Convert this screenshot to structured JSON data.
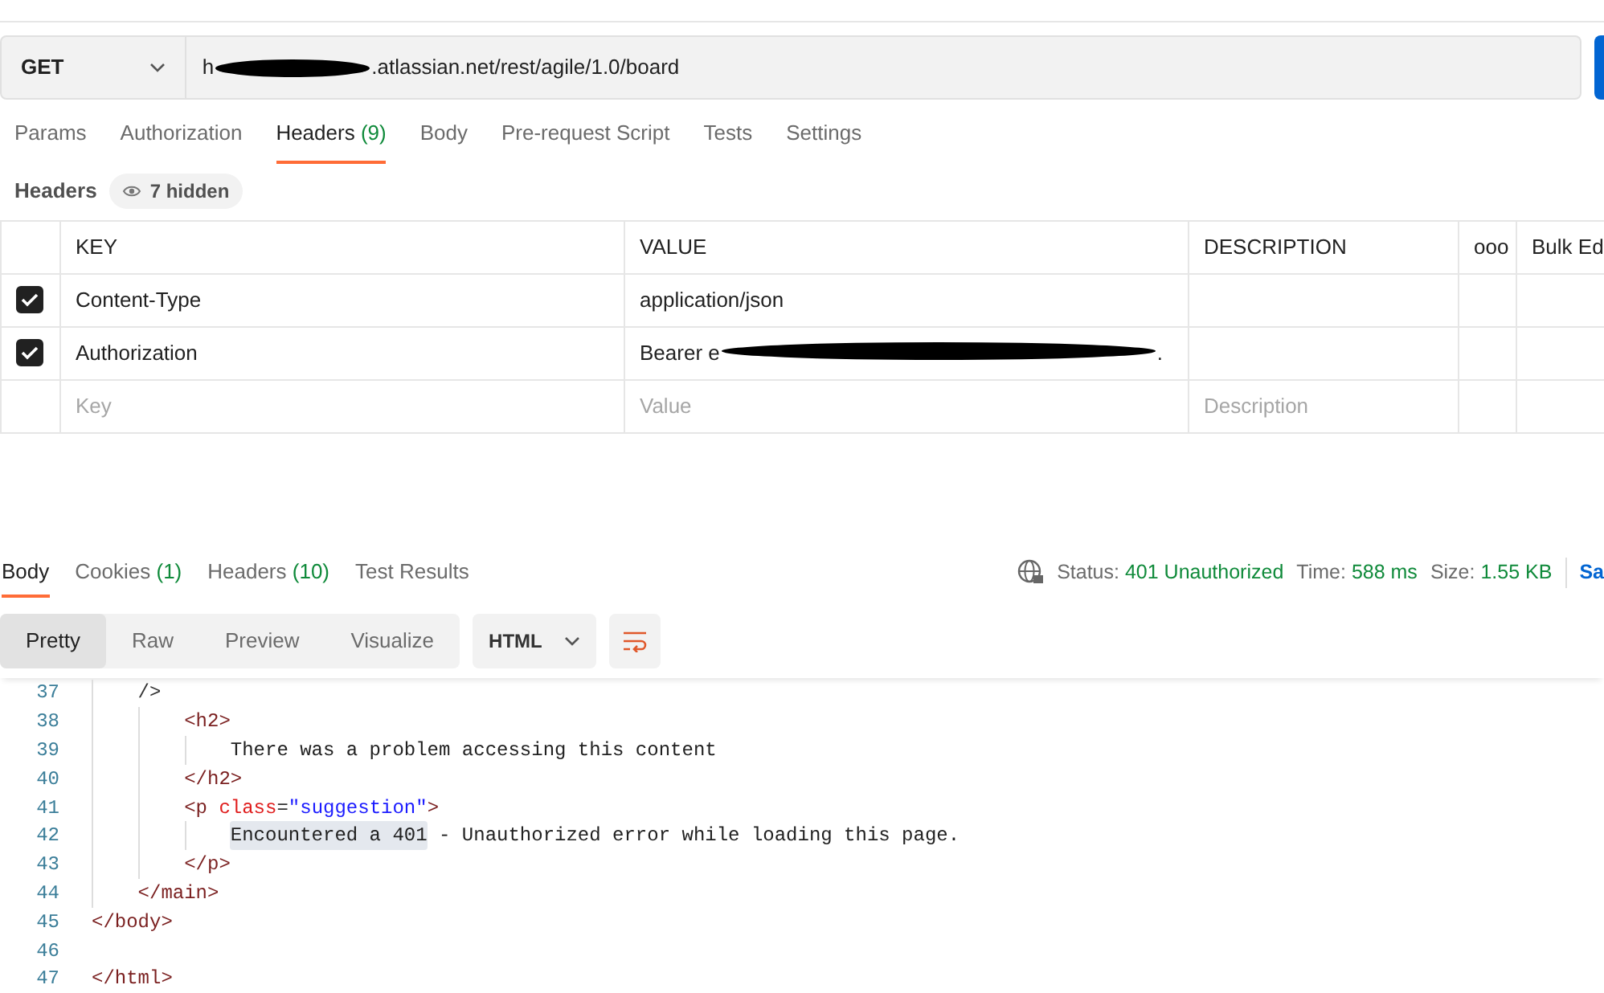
{
  "request": {
    "method": "GET",
    "url_parts": [
      {
        "kind": "text",
        "text": "h"
      },
      {
        "kind": "redaction"
      },
      {
        "kind": "text",
        "text": ".atlassian.net/rest/agile/1.0/board"
      }
    ]
  },
  "request_tabs": [
    {
      "label": "Params",
      "selected": false
    },
    {
      "label": "Authorization",
      "selected": false
    },
    {
      "label": "Headers",
      "count": "(9)",
      "selected": true
    },
    {
      "label": "Body",
      "selected": false
    },
    {
      "label": "Pre-request Script",
      "selected": false
    },
    {
      "label": "Tests",
      "selected": false
    },
    {
      "label": "Settings",
      "selected": false
    }
  ],
  "headers_bar": {
    "title": "Headers",
    "hidden_badge": "7 hidden"
  },
  "headers_table": {
    "columns": [
      "KEY",
      "VALUE",
      "DESCRIPTION"
    ],
    "more": "ooo",
    "bulk_edit": "Bulk Ed",
    "rows": [
      {
        "checked": true,
        "key": "Content-Type",
        "value_parts": [
          {
            "kind": "text",
            "text": "application/json"
          }
        ]
      },
      {
        "checked": true,
        "key": "Authorization",
        "value_parts": [
          {
            "kind": "text",
            "text": "Bearer e"
          },
          {
            "kind": "redaction"
          },
          {
            "kind": "text",
            "text": "."
          }
        ]
      }
    ],
    "new_row": {
      "key": {
        "placeholder": "Key"
      },
      "value": {
        "placeholder": "Value"
      },
      "description": {
        "placeholder": "Description"
      }
    }
  },
  "response_tabs": [
    {
      "label": "Body",
      "selected": true
    },
    {
      "label": "Cookies",
      "count": "(1)",
      "selected": false
    },
    {
      "label": "Headers",
      "count": "(10)",
      "selected": false
    },
    {
      "label": "Test Results",
      "selected": false
    }
  ],
  "response_meta": {
    "status_label": "Status:",
    "status": "401 Unauthorized",
    "time_label": "Time:",
    "time": "588 ms",
    "size_label": "Size:",
    "size": "1.55 KB",
    "save": "Sa"
  },
  "view_modes": [
    {
      "label": "Pretty",
      "selected": true
    },
    {
      "label": "Raw",
      "selected": false
    },
    {
      "label": "Preview",
      "selected": false
    },
    {
      "label": "Visualize",
      "selected": false
    }
  ],
  "format": "HTML",
  "code_lines": [
    {
      "number": "37",
      "tokens": [
        {
          "kind": "indent"
        },
        {
          "kind": "punct",
          "text": "/>"
        }
      ]
    },
    {
      "number": "38",
      "tokens": [
        {
          "kind": "indent"
        },
        {
          "kind": "indent"
        },
        {
          "kind": "tag",
          "text": "<h2>"
        }
      ]
    },
    {
      "number": "39",
      "tokens": [
        {
          "kind": "indent"
        },
        {
          "kind": "indent"
        },
        {
          "kind": "indent"
        },
        {
          "kind": "text",
          "text": "There was a problem accessing this content",
          "highlighted": false
        }
      ]
    },
    {
      "number": "40",
      "tokens": [
        {
          "kind": "indent"
        },
        {
          "kind": "indent"
        },
        {
          "kind": "tag",
          "text": "</h2>"
        }
      ]
    },
    {
      "number": "41",
      "tokens": [
        {
          "kind": "indent"
        },
        {
          "kind": "indent"
        },
        {
          "kind": "tag",
          "text": "<p "
        },
        {
          "kind": "attr",
          "text": "class"
        },
        {
          "kind": "punct",
          "text": "="
        },
        {
          "kind": "string",
          "text": "\"suggestion\""
        },
        {
          "kind": "tag",
          "text": ">"
        }
      ]
    },
    {
      "number": "42",
      "tokens": [
        {
          "kind": "indent"
        },
        {
          "kind": "indent"
        },
        {
          "kind": "indent"
        },
        {
          "kind": "text",
          "text": "Encountered a 401",
          "highlighted": true
        },
        {
          "kind": "text",
          "text": " - Unauthorized error while loading this page.",
          "highlighted": false
        }
      ]
    },
    {
      "number": "43",
      "tokens": [
        {
          "kind": "indent"
        },
        {
          "kind": "indent"
        },
        {
          "kind": "tag",
          "text": "</p>"
        }
      ]
    },
    {
      "number": "44",
      "tokens": [
        {
          "kind": "indent"
        },
        {
          "kind": "tag",
          "text": "</main>"
        }
      ]
    },
    {
      "number": "45",
      "tokens": [
        {
          "kind": "tag",
          "text": "</body>"
        }
      ]
    },
    {
      "number": "46"
    },
    {
      "number": "47",
      "tokens": [
        {
          "kind": "tag",
          "text": "</html>"
        }
      ]
    }
  ]
}
